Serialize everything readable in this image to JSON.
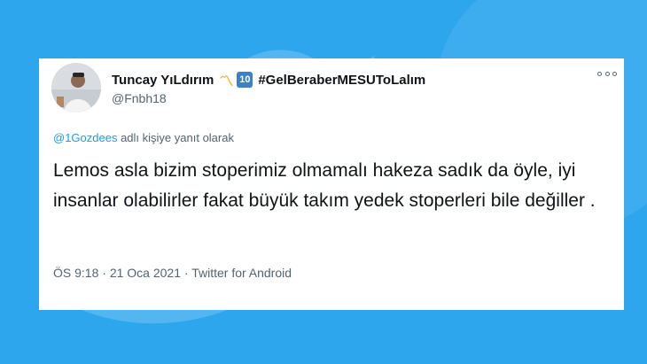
{
  "tweet": {
    "display_name": "Tuncay YıLdırım",
    "emoji_m": "〽",
    "emoji_10": "10",
    "hashtag": "#GelBeraberMESUToLalım",
    "handle": "@Fnbh18",
    "reply_to_user": "@1Gozdees",
    "reply_suffix": " adlı kişiye yanıt olarak",
    "text": "Lemos asla bizim stoperimiz olmamalı hakeza sadık da öyle, iyi insanlar olabilirler fakat büyük takım yedek stoperleri bile değiller .",
    "time": "ÖS 9:18",
    "separator": " · ",
    "date": "21 Oca 2021",
    "source": "Twitter for Android"
  },
  "colors": {
    "background": "#2ea6ee",
    "card": "#ffffff",
    "link": "#1d9bf0",
    "text": "#0f1419",
    "muted": "#536471"
  },
  "icons": {
    "more": "more-icon",
    "background": "twitter-bird-icon"
  }
}
